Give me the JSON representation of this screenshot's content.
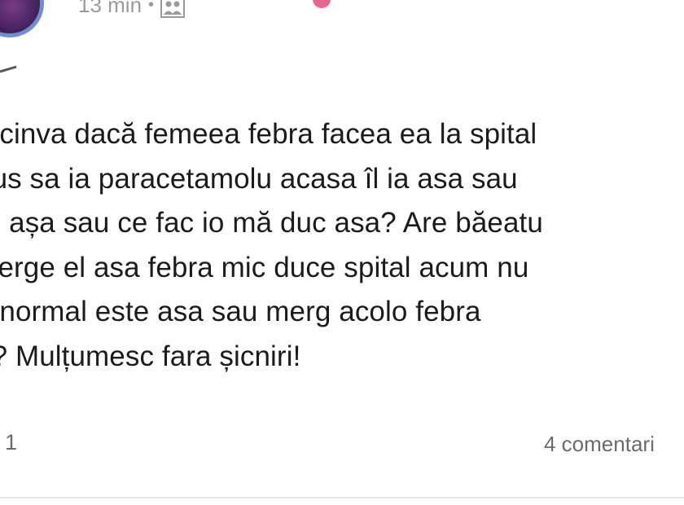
{
  "post": {
    "timestamp": "13 min",
    "separator": "•",
    "audience_icon": "friends-audience-icon",
    "text_lines": [
      "e cinva dacă femeea febra facea ea la spital",
      "dus sa ia paracetamolu acasa îl ia asa sau",
      "rg așa sau ce fac io mă duc asa? Are băeatu",
      "alerge el asa febra mic duce spital acum nu",
      "ă normal este asa sau merg acolo febra",
      "a? Mulțumesc fara șicniri!"
    ]
  },
  "footer": {
    "reactions_count": "1",
    "comments_count": "4 comentari"
  },
  "colors": {
    "avatar_ring": "#6f8fd0",
    "meta_text": "#9a9a9a",
    "body_text": "#1b1b1b",
    "footer_text": "#6b6b6b",
    "accent_pink": "#e24c7a"
  }
}
